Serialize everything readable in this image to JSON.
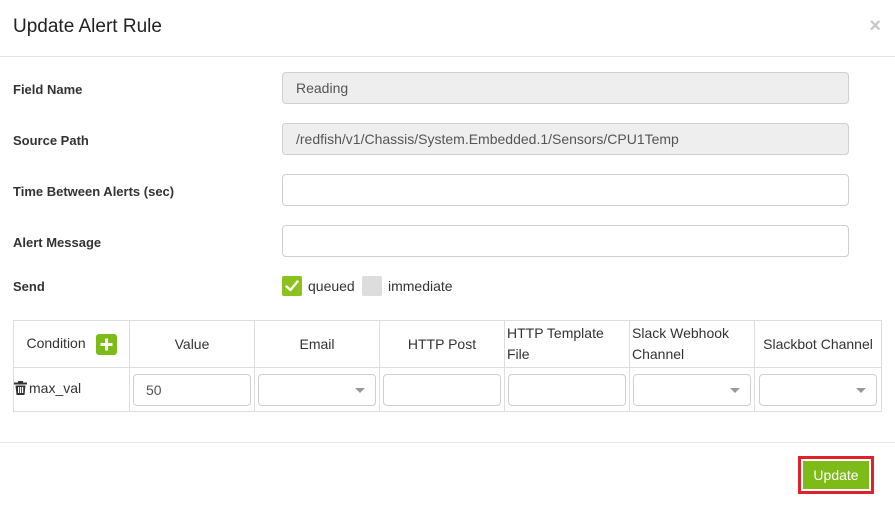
{
  "dialog": {
    "title": "Update Alert Rule",
    "close_glyph": "×"
  },
  "form": {
    "field_name": {
      "label": "Field Name",
      "value": "Reading"
    },
    "source_path": {
      "label": "Source Path",
      "value": "/redfish/v1/Chassis/System.Embedded.1/Sensors/CPU1Temp"
    },
    "time_between_alerts": {
      "label": "Time Between Alerts (sec)",
      "value": ""
    },
    "alert_message": {
      "label": "Alert Message",
      "value": ""
    },
    "send": {
      "label": "Send",
      "options": [
        {
          "label": "queued",
          "checked": true
        },
        {
          "label": "immediate",
          "checked": false
        }
      ]
    }
  },
  "conditions_table": {
    "headers": {
      "condition": "Condition",
      "value": "Value",
      "email": "Email",
      "http_post": "HTTP Post",
      "http_template_file": "HTTP Template File",
      "slack_webhook_channel": "Slack Webhook Channel",
      "slackbot_channel": "Slackbot Channel"
    },
    "rows": [
      {
        "condition": "max_val",
        "value": "50",
        "email": "",
        "http_post": "",
        "http_template_file": "",
        "slack_webhook_channel": "",
        "slackbot_channel": ""
      }
    ]
  },
  "footer": {
    "update_label": "Update"
  },
  "colors": {
    "accent_green": "#7dbb19",
    "highlight_red": "#e0202a",
    "readonly_bg": "#eeeeee"
  },
  "icons": {
    "close": "close-icon",
    "add": "plus-icon",
    "delete": "trash-icon",
    "check": "check-icon",
    "dropdown": "chevron-down-icon"
  }
}
